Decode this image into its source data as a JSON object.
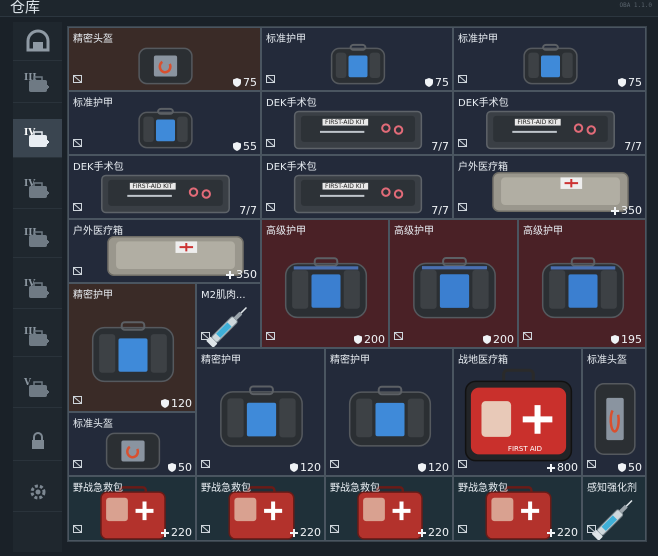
{
  "title": "仓库",
  "version": "OBA 1.1.0",
  "sidebar": [
    {
      "icon": "helmet-icon"
    },
    {
      "icon": "tier-3-armor-icon",
      "tier": "III"
    },
    {
      "icon": "tier-4-medkit-icon",
      "tier": "IV"
    },
    {
      "icon": "tier-4-armor-icon",
      "tier": "IV"
    },
    {
      "icon": "tier-3-armor-icon",
      "tier": "III"
    },
    {
      "icon": "tier-4-armor-icon",
      "tier": "IV"
    },
    {
      "icon": "tier-3-armor-icon",
      "tier": "III"
    },
    {
      "icon": "tier-5-armor-icon",
      "tier": "V"
    },
    {
      "icon": "lock-icon"
    },
    {
      "icon": "gear-icon"
    }
  ],
  "items": [
    {
      "name": "精密头盔",
      "value": "75",
      "vicon": "shield"
    },
    {
      "name": "标准护甲",
      "value": "75",
      "vicon": "shield"
    },
    {
      "name": "标准护甲",
      "value": "75",
      "vicon": "shield"
    },
    {
      "name": "标准护甲",
      "value": "55",
      "vicon": "shield"
    },
    {
      "name": "DEK手术包",
      "value": "7/7",
      "vicon": ""
    },
    {
      "name": "DEK手术包",
      "value": "7/7",
      "vicon": ""
    },
    {
      "name": "DEK手术包",
      "value": "7/7",
      "vicon": ""
    },
    {
      "name": "DEK手术包",
      "value": "7/7",
      "vicon": ""
    },
    {
      "name": "户外医疗箱",
      "value": "350",
      "vicon": "plus"
    },
    {
      "name": "户外医疗箱",
      "value": "350",
      "vicon": "plus"
    },
    {
      "name": "高级护甲",
      "value": "200",
      "vicon": "shield"
    },
    {
      "name": "高级护甲",
      "value": "200",
      "vicon": "shield"
    },
    {
      "name": "高级护甲",
      "value": "195",
      "vicon": "shield"
    },
    {
      "name": "精密护甲",
      "value": "120",
      "vicon": "shield"
    },
    {
      "name": "M2肌肉...",
      "value": "",
      "vicon": ""
    },
    {
      "name": "精密护甲",
      "value": "120",
      "vicon": "shield"
    },
    {
      "name": "精密护甲",
      "value": "120",
      "vicon": "shield"
    },
    {
      "name": "战地医疗箱",
      "value": "800",
      "vicon": "plus"
    },
    {
      "name": "标准头盔",
      "value": "50",
      "vicon": "shield"
    },
    {
      "name": "标准头盔",
      "value": "50",
      "vicon": "shield"
    },
    {
      "name": "野战急救包",
      "value": "220",
      "vicon": "plus"
    },
    {
      "name": "野战急救包",
      "value": "220",
      "vicon": "plus"
    },
    {
      "name": "野战急救包",
      "value": "220",
      "vicon": "plus"
    },
    {
      "name": "野战急救包",
      "value": "220",
      "vicon": "plus"
    },
    {
      "name": "感知强化剂",
      "value": "",
      "vicon": ""
    }
  ],
  "colors": {
    "cell_blue": "#232a3a",
    "cell_brown": "#3a2b27",
    "cell_red": "#4a2126",
    "cell_teal": "#1f3039",
    "medkit_red": "#c0332d"
  }
}
